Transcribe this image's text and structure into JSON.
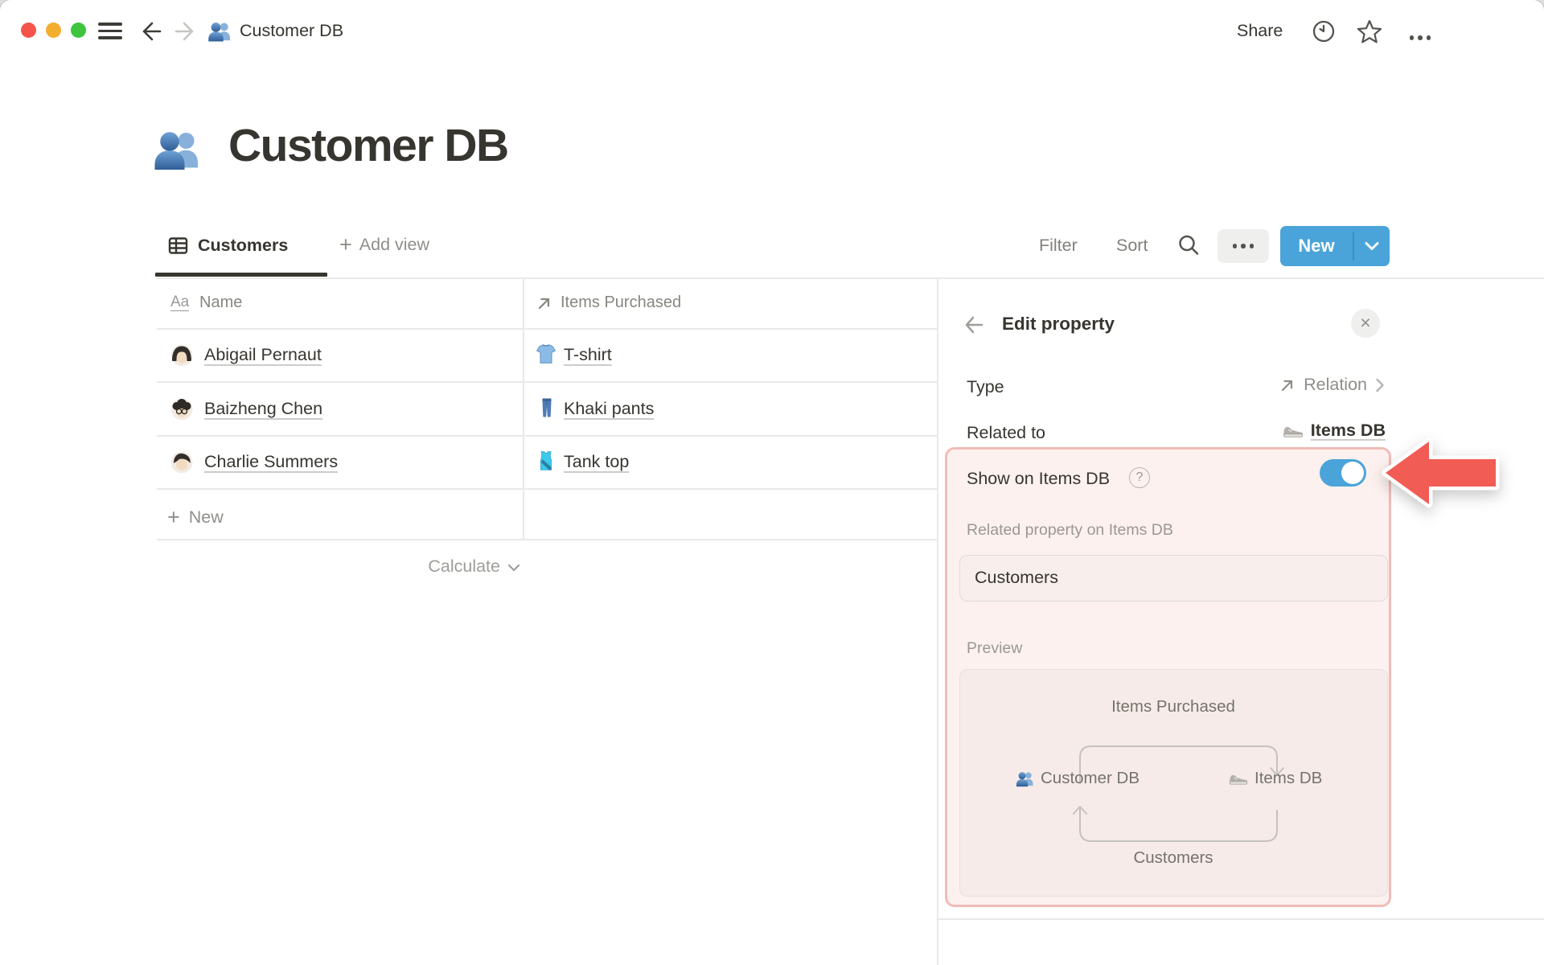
{
  "titlebar": {
    "breadcrumb": "Customer DB",
    "share_label": "Share"
  },
  "page": {
    "title": "Customer DB"
  },
  "toolbar": {
    "active_view": "Customers",
    "add_view_label": "Add view",
    "filter_label": "Filter",
    "sort_label": "Sort",
    "new_label": "New"
  },
  "table": {
    "columns": [
      {
        "label": "Name"
      },
      {
        "label": "Items Purchased"
      }
    ],
    "rows": [
      {
        "name": "Abigail Pernaut",
        "item": "T-shirt"
      },
      {
        "name": "Baizheng Chen",
        "item": "Khaki pants"
      },
      {
        "name": "Charlie Summers",
        "item": "Tank top"
      }
    ],
    "new_row_label": "New",
    "calculate_label": "Calculate"
  },
  "panel": {
    "title": "Edit property",
    "type_label": "Type",
    "type_value": "Relation",
    "related_label": "Related to",
    "related_value": "Items DB",
    "highlight": {
      "show_label": "Show on Items DB",
      "help_glyph": "?",
      "toggle_state": "on",
      "related_property_label": "Related property on Items DB",
      "related_property_value": "Customers",
      "preview_label": "Preview",
      "preview": {
        "top": "Items Purchased",
        "left": "Customer DB",
        "right": "Items DB",
        "bottom": "Customers"
      }
    }
  },
  "colors": {
    "accent_blue": "#4AA4D9",
    "highlight_bg": "#FCF1EF",
    "highlight_border": "#F2BCB7",
    "arrow_red": "#F15C55"
  }
}
